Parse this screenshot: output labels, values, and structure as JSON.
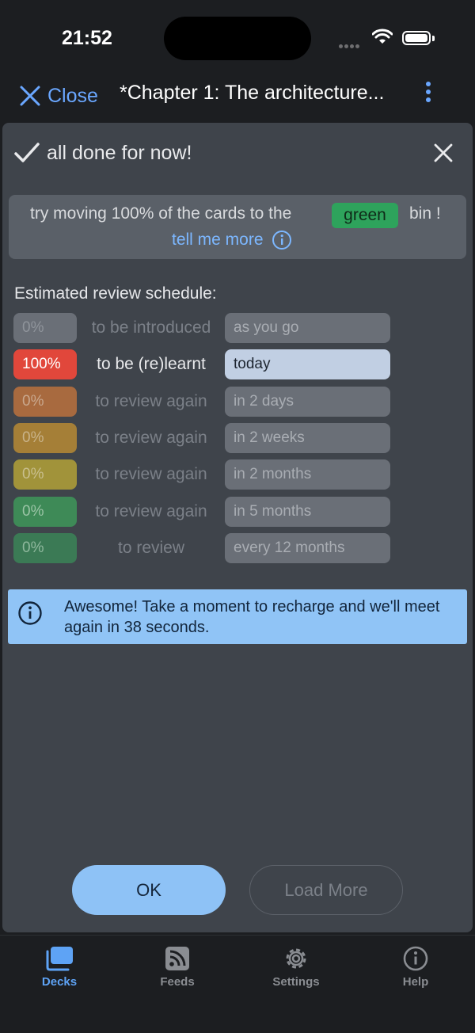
{
  "status_bar": {
    "time": "21:52"
  },
  "nav": {
    "close_label": "Close",
    "title": "*Chapter 1: The architecture..."
  },
  "sheet": {
    "title": "all done for now!",
    "tip": {
      "text_before": "try moving 100% of the cards to the",
      "bin_color_word": "green",
      "text_after": "bin !",
      "link": "tell me more"
    },
    "schedule_label": "Estimated review schedule:",
    "rows": [
      {
        "pct": "0%",
        "label": "to be introduced",
        "when": "as you go",
        "color": "#6a6f77",
        "text_color": "#8f949b",
        "active": false
      },
      {
        "pct": "100%",
        "label": "to be (re)learnt",
        "when": "today",
        "color": "#e1473b",
        "text_color": "#ffffff",
        "active": true
      },
      {
        "pct": "0%",
        "label": "to review again",
        "when": "in 2 days",
        "color": "#a86a3f",
        "text_color": "#c9a88e",
        "active": false
      },
      {
        "pct": "0%",
        "label": "to review again",
        "when": "in 2 weeks",
        "color": "#a57f37",
        "text_color": "#c9b38a",
        "active": false
      },
      {
        "pct": "0%",
        "label": "to review again",
        "when": "in 2 months",
        "color": "#a1933a",
        "text_color": "#c9bf8e",
        "active": false
      },
      {
        "pct": "0%",
        "label": "to review again",
        "when": "in 5 months",
        "color": "#3e8a57",
        "text_color": "#9bc4a6",
        "active": false
      },
      {
        "pct": "0%",
        "label": "to review",
        "when": "every 12 months",
        "color": "#3b7a55",
        "text_color": "#8fb89d",
        "active": false
      }
    ],
    "info_text": "Awesome! Take a moment to recharge and we'll meet again in 38 seconds.",
    "ok_label": "OK",
    "load_more_label": "Load More"
  },
  "tabs": [
    {
      "label": "Decks",
      "icon": "decks-icon",
      "active": true
    },
    {
      "label": "Feeds",
      "icon": "rss-icon",
      "active": false
    },
    {
      "label": "Settings",
      "icon": "gear-icon",
      "active": false
    },
    {
      "label": "Help",
      "icon": "info-icon",
      "active": false
    }
  ]
}
